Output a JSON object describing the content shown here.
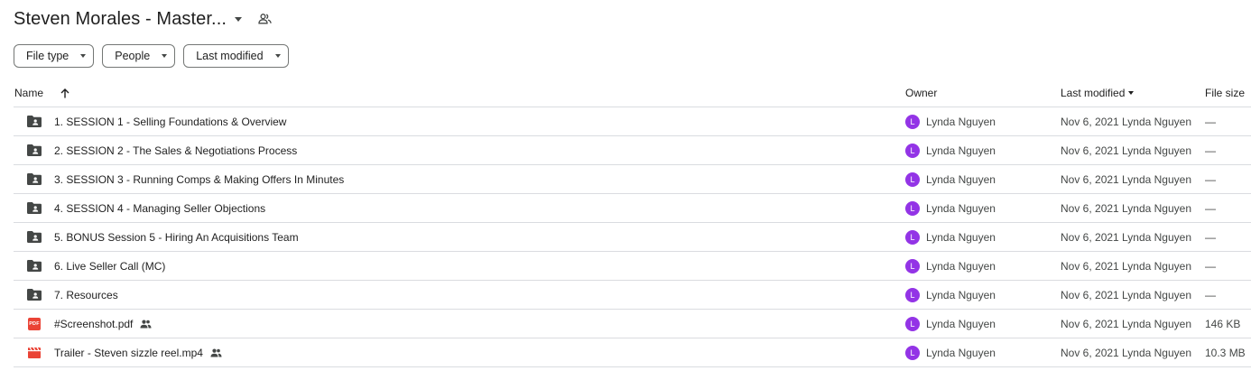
{
  "header": {
    "title": "Steven Morales - Master...",
    "caret_icon": "chevron-down-icon",
    "shared_icon": "people-icon"
  },
  "filters": [
    {
      "label": "File type"
    },
    {
      "label": "People"
    },
    {
      "label": "Last modified"
    }
  ],
  "columns": {
    "name": "Name",
    "owner": "Owner",
    "last_modified": "Last modified",
    "file_size": "File size",
    "sort_icon": "arrow-up-icon",
    "sort_direction": "ascending"
  },
  "files": [
    {
      "name": "1. SESSION 1 - Selling Foundations & Overview",
      "type": "shared-folder",
      "shared": false,
      "owner_initial": "L",
      "owner": "Lynda Nguyen",
      "modified": "Nov 6, 2021 Lynda Nguyen",
      "size": "—"
    },
    {
      "name": "2. SESSION 2 - The Sales & Negotiations Process",
      "type": "shared-folder",
      "shared": false,
      "owner_initial": "L",
      "owner": "Lynda Nguyen",
      "modified": "Nov 6, 2021 Lynda Nguyen",
      "size": "—"
    },
    {
      "name": "3. SESSION 3 - Running Comps & Making Offers In Minutes",
      "type": "shared-folder",
      "shared": false,
      "owner_initial": "L",
      "owner": "Lynda Nguyen",
      "modified": "Nov 6, 2021 Lynda Nguyen",
      "size": "—"
    },
    {
      "name": "4. SESSION 4 - Managing Seller Objections",
      "type": "shared-folder",
      "shared": false,
      "owner_initial": "L",
      "owner": "Lynda Nguyen",
      "modified": "Nov 6, 2021 Lynda Nguyen",
      "size": "—"
    },
    {
      "name": "5. BONUS Session 5 - Hiring An Acquisitions Team",
      "type": "shared-folder",
      "shared": false,
      "owner_initial": "L",
      "owner": "Lynda Nguyen",
      "modified": "Nov 6, 2021 Lynda Nguyen",
      "size": "—"
    },
    {
      "name": "6. Live Seller Call (MC)",
      "type": "shared-folder",
      "shared": false,
      "owner_initial": "L",
      "owner": "Lynda Nguyen",
      "modified": "Nov 6, 2021 Lynda Nguyen",
      "size": "—"
    },
    {
      "name": "7. Resources",
      "type": "shared-folder",
      "shared": false,
      "owner_initial": "L",
      "owner": "Lynda Nguyen",
      "modified": "Nov 6, 2021 Lynda Nguyen",
      "size": "—"
    },
    {
      "name": "#Screenshot.pdf",
      "type": "pdf",
      "type_badge": "PDF",
      "shared": true,
      "owner_initial": "L",
      "owner": "Lynda Nguyen",
      "modified": "Nov 6, 2021 Lynda Nguyen",
      "size": "146 KB"
    },
    {
      "name": "Trailer - Steven sizzle reel.mp4",
      "type": "video",
      "shared": true,
      "owner_initial": "L",
      "owner": "Lynda Nguyen",
      "modified": "Nov 6, 2021 Lynda Nguyen",
      "size": "10.3 MB"
    }
  ],
  "colors": {
    "avatar": "#9334e6",
    "folder_icon": "#444746",
    "pdf_icon": "#ea4335",
    "video_icon": "#ea4335",
    "divider": "#dadce0"
  }
}
